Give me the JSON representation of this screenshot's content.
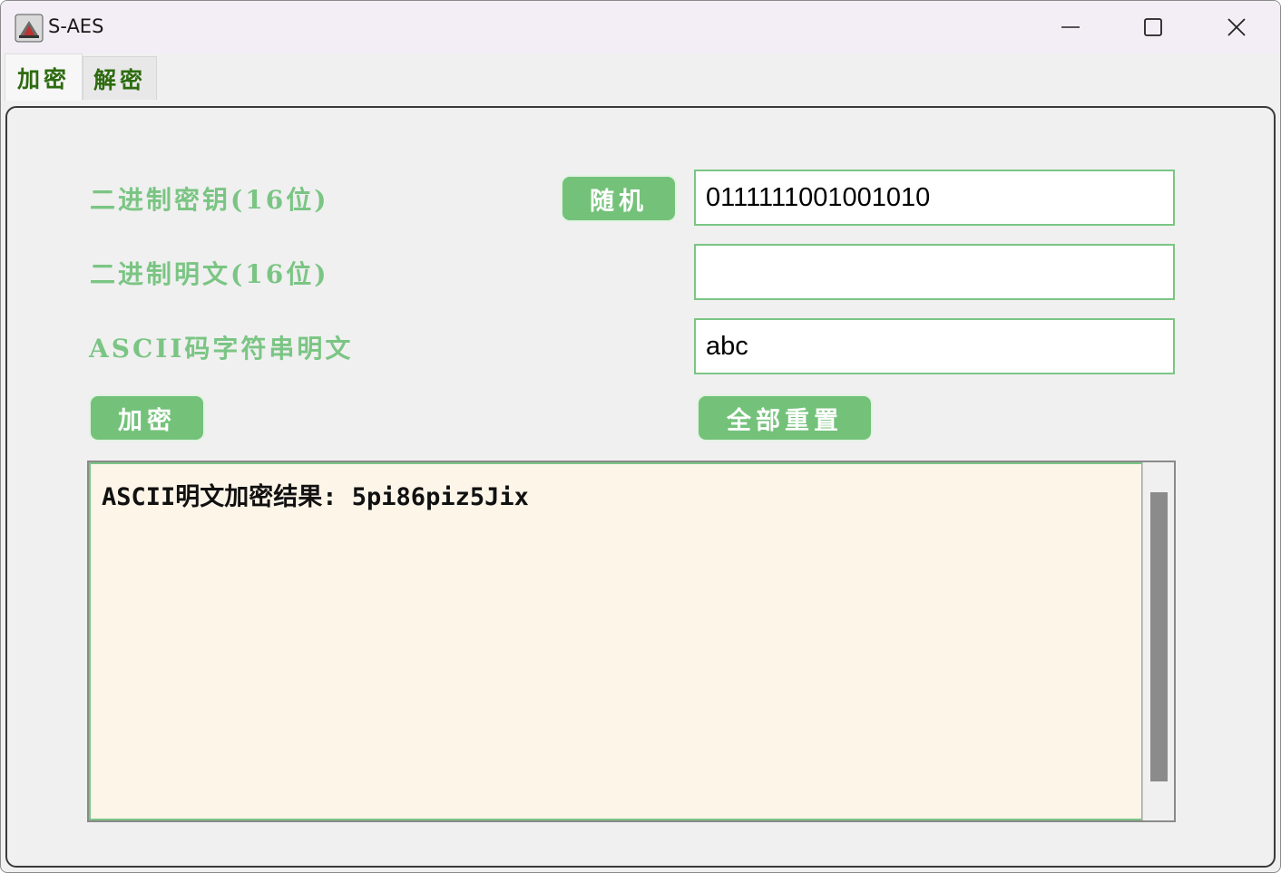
{
  "window": {
    "title": "S-AES"
  },
  "tabs": [
    {
      "label": "加密"
    },
    {
      "label": "解密"
    }
  ],
  "form": {
    "key_label": "二进制密钥(16位)",
    "random_button": "随机",
    "key_value": "0111111001001010",
    "plaintext_label": "二进制明文(16位)",
    "plaintext_value": "",
    "ascii_label": "ASCII码字符串明文",
    "ascii_value": "abc",
    "encrypt_button": "加密",
    "reset_button": "全部重置"
  },
  "output": {
    "text": "ASCII明文加密结果: 5pi86piz5Jix"
  },
  "colors": {
    "accent_green": "#74c27a",
    "label_green": "#7bc584",
    "tab_text": "#2d6b10",
    "output_bg": "#fdf5e8"
  }
}
